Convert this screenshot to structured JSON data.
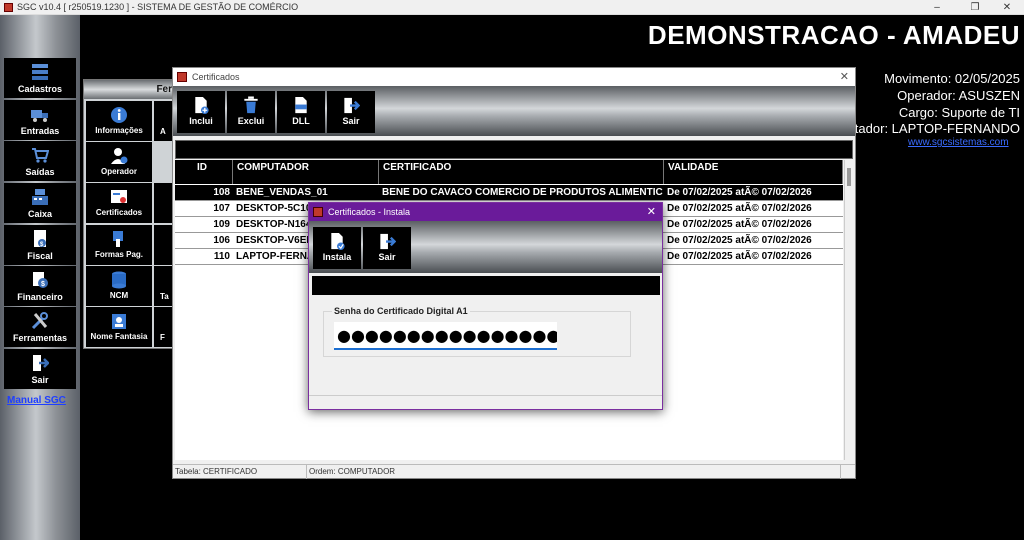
{
  "window": {
    "title": "SGC v10.4 [ r250519.1230 ] - SISTEMA DE GESTÃO DE COMÉRCIO"
  },
  "nav": {
    "items": [
      {
        "label": "Cadastros",
        "icon": "stack-icon"
      },
      {
        "label": "Entradas",
        "icon": "truck-icon"
      },
      {
        "label": "Saídas",
        "icon": "cart-icon"
      },
      {
        "label": "Caixa",
        "icon": "cash-register-icon"
      },
      {
        "label": "Fiscal",
        "icon": "document-dollar-icon"
      },
      {
        "label": "Financeiro",
        "icon": "money-icon"
      },
      {
        "label": "Ferramentas",
        "icon": "tools-icon"
      },
      {
        "label": "Sair",
        "icon": "exit-icon"
      }
    ],
    "manual_link": "Manual SGC"
  },
  "sub_panel": {
    "title": "Fer",
    "items": [
      {
        "label": "Informações",
        "icon": "info-icon"
      },
      {
        "label": "Operador",
        "icon": "operator-icon"
      },
      {
        "label": "Certificados",
        "icon": "certificate-icon"
      },
      {
        "label": "Formas Pag.",
        "icon": "payment-icon"
      },
      {
        "label": "NCM",
        "icon": "database-icon"
      },
      {
        "label": "Nome Fantasia",
        "icon": "badge-icon"
      }
    ],
    "partial_labels": [
      "A",
      "",
      "",
      "",
      "Ta",
      "F"
    ]
  },
  "header": {
    "company": "DEMONSTRACAO - AMADEU",
    "movimento": "Movimento: 02/05/2025",
    "operador": "Operador: ASUSZEN",
    "cargo": "Cargo: Suporte de TI",
    "computador": "utador: LAPTOP-FERNANDO",
    "site": "www.sgcsistemas.com"
  },
  "cert_window": {
    "title": "Certificados",
    "toolbar": [
      {
        "label": "Inclui",
        "icon": "add-document-icon"
      },
      {
        "label": "Exclui",
        "icon": "trash-icon"
      },
      {
        "label": "DLL",
        "icon": "dll-icon"
      },
      {
        "label": "Sair",
        "icon": "exit-icon"
      }
    ],
    "columns": [
      "ID",
      "COMPUTADOR",
      "CERTIFICADO",
      "VALIDADE"
    ],
    "rows": [
      {
        "id": "108",
        "computador": "BENE_VENDAS_01",
        "certificado": "BENE DO CAVACO COMERCIO DE PRODUTOS ALIMENTIC",
        "validade": "De 07/02/2025 atÃ© 07/02/2026"
      },
      {
        "id": "107",
        "computador": "DESKTOP-5C10",
        "certificado": "",
        "validade": "De 07/02/2025 atÃ© 07/02/2026"
      },
      {
        "id": "109",
        "computador": "DESKTOP-N164",
        "certificado": "",
        "validade": "De 07/02/2025 atÃ© 07/02/2026"
      },
      {
        "id": "106",
        "computador": "DESKTOP-V6EF",
        "certificado": "",
        "validade": "De 07/02/2025 atÃ© 07/02/2026"
      },
      {
        "id": "110",
        "computador": "LAPTOP-FERNA",
        "certificado": "",
        "validade": "De 07/02/2025 atÃ© 07/02/2026"
      }
    ],
    "status": {
      "tabela": "Tabela: CERTIFICADO",
      "ordem": "Ordem: COMPUTADOR"
    }
  },
  "dialog": {
    "title": "Certificados - Instala",
    "toolbar": [
      {
        "label": "Instala",
        "icon": "install-icon"
      },
      {
        "label": "Sair",
        "icon": "exit-icon"
      }
    ],
    "fieldset_label": "Senha do Certificado Digital A1",
    "password_value": "●●●●●●●●●●●●●●●●●●●●●●"
  },
  "colors": {
    "dialog_title": "#6a1b9a",
    "link": "#1f3fff",
    "focus_underline": "#1d6fd1"
  }
}
